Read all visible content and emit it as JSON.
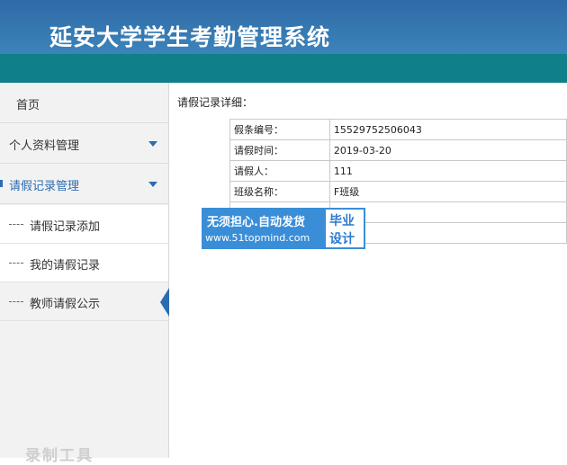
{
  "header": {
    "title": "延安大学学生考勤管理系统"
  },
  "sidebar": {
    "items": [
      {
        "label": "首页"
      },
      {
        "label": "个人资料管理"
      },
      {
        "label": "请假记录管理"
      }
    ],
    "subitems": [
      {
        "label": "请假记录添加"
      },
      {
        "label": "我的请假记录"
      },
      {
        "label": "教师请假公示"
      }
    ],
    "watermark": "录制工具"
  },
  "main": {
    "section_title": "请假记录详细：",
    "rows": [
      {
        "label": "假条编号：",
        "value": "15529752506043"
      },
      {
        "label": "请假时间：",
        "value": "2019-03-20"
      },
      {
        "label": "请假人：",
        "value": "111"
      },
      {
        "label": "班级名称：",
        "value": "F班级"
      },
      {
        "label": "",
        "value": ""
      },
      {
        "label": "",
        "value": ""
      }
    ]
  },
  "promo": {
    "line1": "无须担心.自动发货",
    "line2": "www.51topmind.com",
    "right1": "毕业",
    "right2": "设计"
  },
  "colors": {
    "header": "#3b82b9",
    "band": "#0f7f8a",
    "accent": "#2b6cb3"
  }
}
